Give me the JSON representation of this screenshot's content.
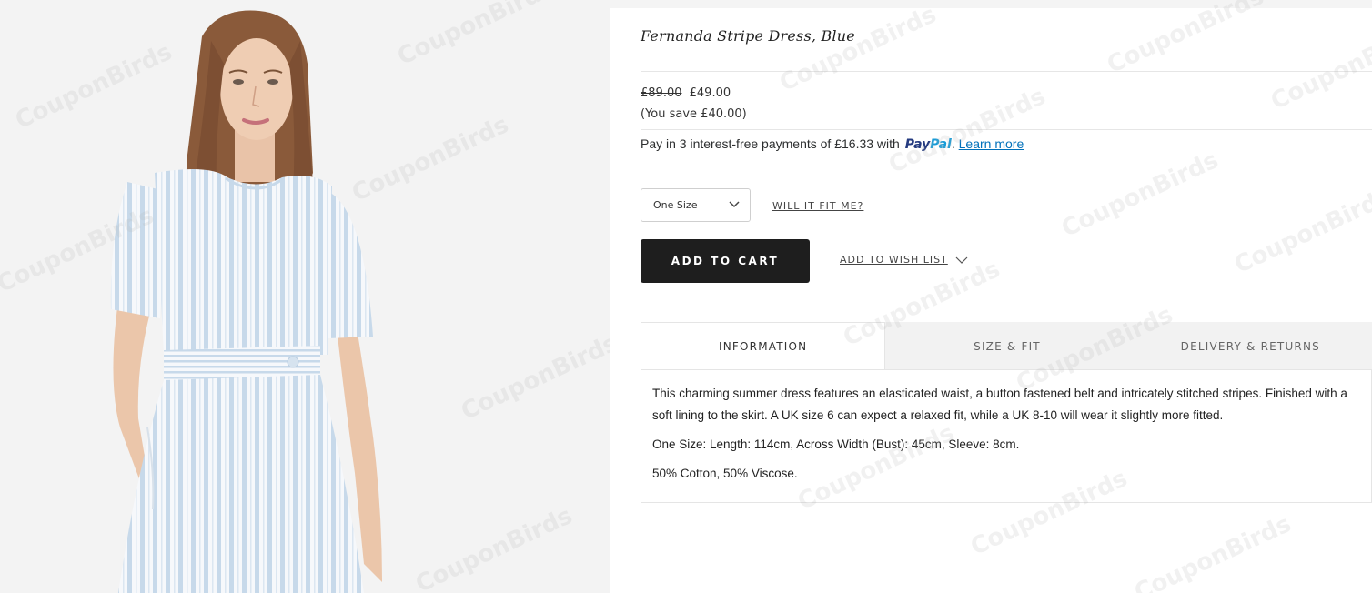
{
  "product": {
    "title": "Fernanda Stripe Dress, Blue",
    "old_price": "£89.00",
    "price": "£49.00",
    "savings": "(You save £40.00)"
  },
  "paypal": {
    "text": "Pay in 3 interest-free payments of £16.33 with",
    "logo_pay": "Pay",
    "logo_pal": "Pal",
    "period": ".",
    "learn_more": "Learn more",
    "colors": {
      "pay": "#253b80",
      "pal": "#179bd7",
      "link": "#0070ba"
    }
  },
  "size_select": {
    "selected": "One Size",
    "icon": "chevron-down-icon"
  },
  "fit_link": "WILL IT FIT ME?",
  "add_to_cart": "ADD TO CART",
  "wish_list": {
    "label": "ADD TO WISH LIST",
    "icon": "chevron-down-icon"
  },
  "tabs": [
    {
      "label": "INFORMATION",
      "active": true
    },
    {
      "label": "SIZE & FIT",
      "active": false
    },
    {
      "label": "DELIVERY & RETURNS",
      "active": false
    }
  ],
  "information": {
    "paragraphs": [
      "This charming summer dress features an elasticated waist, a button fastened belt and intricately stitched stripes. Finished with a soft lining to the skirt. A UK size 6 can expect a relaxed fit, while a UK 8-10 will wear it slightly more fitted.",
      "One Size: Length: 114cm, Across Width (Bust): 45cm, Sleeve: 8cm.",
      "50% Cotton, 50% Viscose."
    ]
  },
  "watermark": "CouponBirds",
  "colors": {
    "button_bg": "#1e1e1e",
    "page_bg": "#f4f4f4",
    "panel_bg": "#ffffff"
  }
}
